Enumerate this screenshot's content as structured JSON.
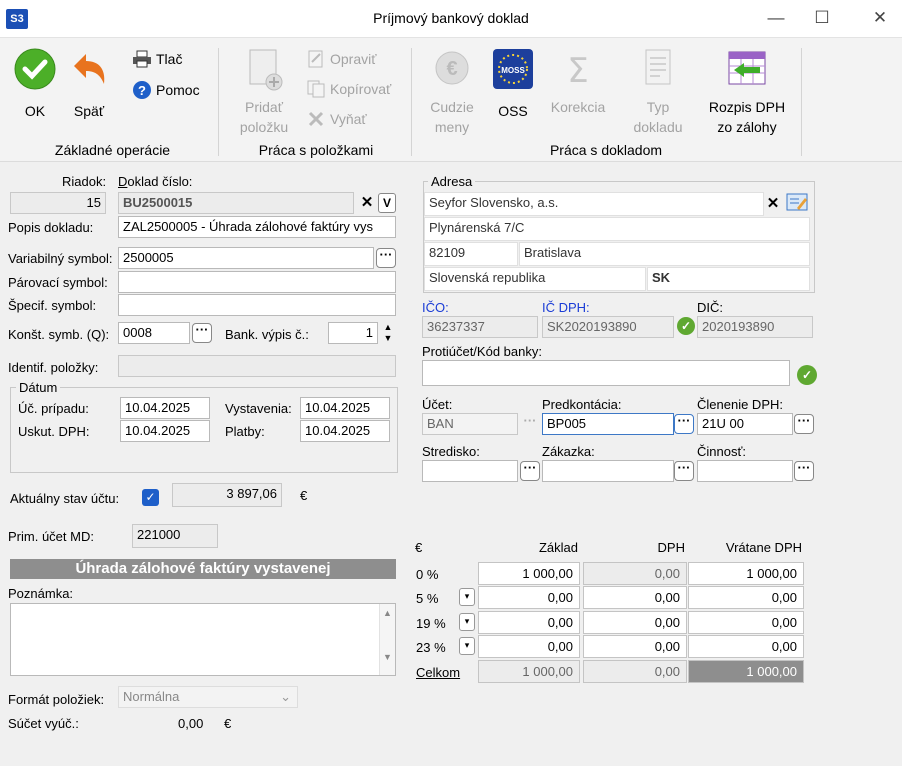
{
  "window": {
    "app_logo": "S3",
    "title": "Príjmový bankový doklad",
    "minimize_glyph": "—",
    "maximize_glyph": "☐",
    "close_glyph": "✕"
  },
  "ribbon": {
    "ok": "OK",
    "back": "Späť",
    "print": "Tlač",
    "help": "Pomoc",
    "group_basic": "Základné operácie",
    "add_line1": "Pridať",
    "add_line2": "položku",
    "edit": "Opraviť",
    "copy": "Kopírovať",
    "remove": "Vyňať",
    "group_items": "Práca s položkami",
    "foreign_line1": "Cudzie",
    "foreign_line2": "meny",
    "oss": "OSS",
    "oss_logo": "MOSS",
    "correction": "Korekcia",
    "doctype_line1": "Typ",
    "doctype_line2": "dokladu",
    "breakdown_line1": "Rozpis DPH",
    "breakdown_line2": "zo zálohy",
    "group_doc": "Práca s dokladom"
  },
  "form": {
    "row_label": "Riadok:",
    "row_value": "15",
    "docno_label": "Doklad číslo:",
    "docno_value": "BU2500015",
    "desc_label": "Popis dokladu:",
    "desc_value": "ZAL2500005 - Úhrada zálohové faktúry vys",
    "varsym_label": "Variabilný symbol:",
    "varsym_value": "2500005",
    "pairsym_label": "Párovací symbol:",
    "pairsym_value": "",
    "specsym_label": "Špecif. symbol:",
    "specsym_value": "",
    "constsym_label": "Konšt. symb. (Q):",
    "constsym_value": "0008",
    "bankstmt_label": "Bank. výpis č.:",
    "bankstmt_value": "1",
    "itemid_label": "Identif. položky:",
    "dates_group": "Dátum",
    "acc_date_label": "Úč. prípadu:",
    "acc_date": "10.04.2025",
    "issue_label": "Vystavenia:",
    "issue_date": "10.04.2025",
    "vat_date_label": "Uskut. DPH:",
    "vat_date": "10.04.2025",
    "pay_label": "Platby:",
    "pay_date": "10.04.2025",
    "balance_label": "Aktuálny stav účtu:",
    "balance_value": "3 897,06",
    "balance_currency": "€",
    "prim_label": "Prim. účet MD:",
    "prim_value": "221000",
    "banner": "Úhrada zálohové faktúry vystavenej",
    "note_label": "Poznámka:",
    "format_label": "Formát položiek:",
    "format_value": "Normálna",
    "sum_label": "Súčet vyúč.:",
    "sum_value": "0,00",
    "sum_currency": "€"
  },
  "address": {
    "group": "Adresa",
    "name": "Seyfor Slovensko, a.s.",
    "street": "Plynárenská 7/C",
    "zip": "82109",
    "city": "Bratislava",
    "country": "Slovenská republika",
    "country_code": "SK"
  },
  "ids": {
    "ico_label": "IČO:",
    "ico": "36237337",
    "icdph_label": "IČ DPH:",
    "icdph": "SK2020193890",
    "dic_label": "DIČ:",
    "dic": "2020193890",
    "counter_label": "Protiúčet/Kód banky:",
    "counter_value": "",
    "account_label": "Účet:",
    "account": "BAN",
    "predkont_label": "Predkontácia:",
    "predkont": "BP005",
    "vatsplit_label": "Členenie DPH:",
    "vatsplit": "21U 00",
    "center_label": "Stredisko:",
    "order_label": "Zákazka:",
    "activity_label": "Činnosť:"
  },
  "vat_table": {
    "currency": "€",
    "headers": [
      "Základ",
      "DPH",
      "Vrátane DPH"
    ],
    "rows": [
      {
        "rate": "0 %",
        "base": "1 000,00",
        "vat": "0,00",
        "total": "1 000,00"
      },
      {
        "rate": "5 %",
        "base": "0,00",
        "vat": "0,00",
        "total": "0,00"
      },
      {
        "rate": "19 %",
        "base": "0,00",
        "vat": "0,00",
        "total": "0,00"
      },
      {
        "rate": "23 %",
        "base": "0,00",
        "vat": "0,00",
        "total": "0,00"
      }
    ],
    "total_label": "Celkom",
    "total_base": "1 000,00",
    "total_vat": "0,00",
    "total_total": "1 000,00"
  },
  "colors": {
    "accent_blue": "#1a3cd6",
    "ok_green": "#4caf28",
    "back_orange": "#e8731e"
  }
}
